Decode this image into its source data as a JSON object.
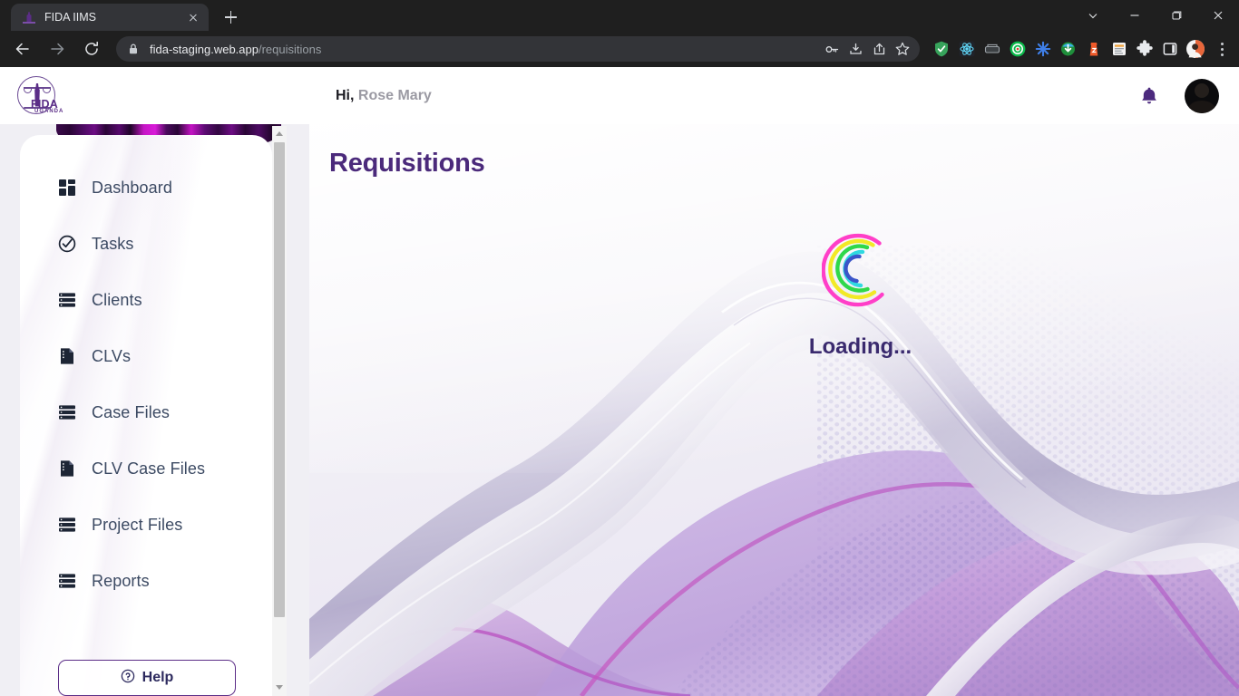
{
  "browser": {
    "tab": {
      "title": "FIDA IIMS",
      "favicon": "fida-favicon"
    },
    "new_tab_label": "+",
    "url": {
      "host": "fida-staging.web.app",
      "path": "/requisitions",
      "security": "lock-icon"
    },
    "nav": {
      "back": "back-icon",
      "forward": "forward-icon",
      "reload": "reload-icon"
    },
    "omnibox_actions": [
      "password-key-icon",
      "install-app-icon",
      "share-icon",
      "bookmark-star-icon"
    ],
    "extensions": [
      {
        "name": "brave-shield-icon",
        "color": "#37a35b"
      },
      {
        "name": "react-devtools-icon",
        "color": "#20232a"
      },
      {
        "name": "scanner-icon",
        "color": "#3c4043"
      },
      {
        "name": "target-tracker-icon",
        "color": "#0bb84a"
      },
      {
        "name": "asterisk-icon",
        "color": "#3f7fe8"
      },
      {
        "name": "idm-icon",
        "color": "#1f8f3b"
      },
      {
        "name": "lighthouse-icon",
        "color": "#ef5a2a"
      },
      {
        "name": "notes-icon",
        "color": "#f2f2f2"
      },
      {
        "name": "puzzle-extensions-icon",
        "color": "#e8eaed"
      },
      {
        "name": "side-panel-icon",
        "color": "#e8eaed"
      },
      {
        "name": "profile-avatar-icon",
        "color": "#e8663a"
      }
    ],
    "menu": "three-dot-menu-icon",
    "window_controls": [
      "chevron-down-icon",
      "minimize-icon",
      "maximize-icon",
      "close-icon"
    ]
  },
  "app": {
    "logo": {
      "name": "FIDA",
      "subtitle": "UGANDA"
    },
    "greeting": {
      "hi": "Hi,",
      "user": "Rose Mary"
    },
    "notifications_icon": "bell-icon",
    "avatar": "user-avatar"
  },
  "sidebar": {
    "items": [
      {
        "label": "Dashboard",
        "icon": "dashboard-grid-icon"
      },
      {
        "label": "Tasks",
        "icon": "check-circle-icon"
      },
      {
        "label": "Clients",
        "icon": "list-rows-icon"
      },
      {
        "label": "CLVs",
        "icon": "document-icon"
      },
      {
        "label": "Case Files",
        "icon": "list-rows-icon"
      },
      {
        "label": "CLV Case Files",
        "icon": "document-icon"
      },
      {
        "label": "Project Files",
        "icon": "list-rows-icon"
      },
      {
        "label": "Reports",
        "icon": "list-rows-icon"
      }
    ],
    "help": {
      "label": "Help",
      "icon": "question-circle-icon"
    },
    "scrollbar": {
      "up": "scroll-up-arrow",
      "down": "scroll-down-arrow"
    }
  },
  "main": {
    "title": "Requisitions",
    "loading_text": "Loading...",
    "spinner": {
      "name": "multicolor-arc-spinner",
      "colors": [
        "#ff3fc8",
        "#f2e927",
        "#2fd84a",
        "#2fd9e0",
        "#3b55c9"
      ]
    }
  },
  "colors": {
    "brand_purple": "#5b2d87",
    "title_purple": "#4b2a7b",
    "loading_purple": "#3a2a6e",
    "nav_text": "#3c4a63",
    "chrome_bg": "#1f1f1f"
  }
}
